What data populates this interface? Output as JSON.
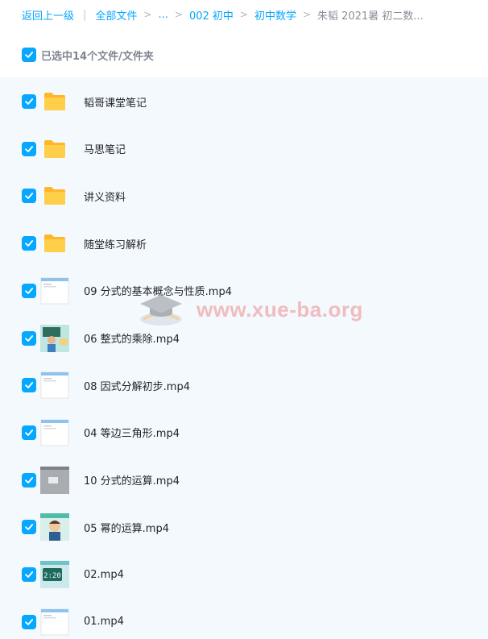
{
  "breadcrumb": {
    "back": "返回上一级",
    "items": [
      "全部文件",
      "...",
      "002 初中",
      "初中数学"
    ],
    "current": "朱韬 2021暑 初二数..."
  },
  "selection": {
    "label": "已选中14个文件/文件夹",
    "checked": true
  },
  "files": [
    {
      "name": "韬哥课堂笔记",
      "type": "folder"
    },
    {
      "name": "马思笔记",
      "type": "folder"
    },
    {
      "name": "讲义资料",
      "type": "folder"
    },
    {
      "name": "随堂练习解析",
      "type": "folder"
    },
    {
      "name": "09 分式的基本概念与性质.mp4",
      "type": "video",
      "thumb": "screen"
    },
    {
      "name": "06 整式的乘除.mp4",
      "type": "video",
      "thumb": "classroom"
    },
    {
      "name": "08 因式分解初步.mp4",
      "type": "video",
      "thumb": "screen"
    },
    {
      "name": "04 等边三角形.mp4",
      "type": "video",
      "thumb": "screen"
    },
    {
      "name": "10 分式的运算.mp4",
      "type": "video",
      "thumb": "gray"
    },
    {
      "name": "05 幂的运算.mp4",
      "type": "video",
      "thumb": "cartoon"
    },
    {
      "name": "02.mp4",
      "type": "video",
      "thumb": "clock"
    },
    {
      "name": "01.mp4",
      "type": "video",
      "thumb": "screen"
    }
  ],
  "watermark": {
    "text": "www.xue-ba.org"
  },
  "colors": {
    "accent": "#06a7ff",
    "folder": "#ffc93c",
    "list_bg": "#f4f9fe"
  }
}
